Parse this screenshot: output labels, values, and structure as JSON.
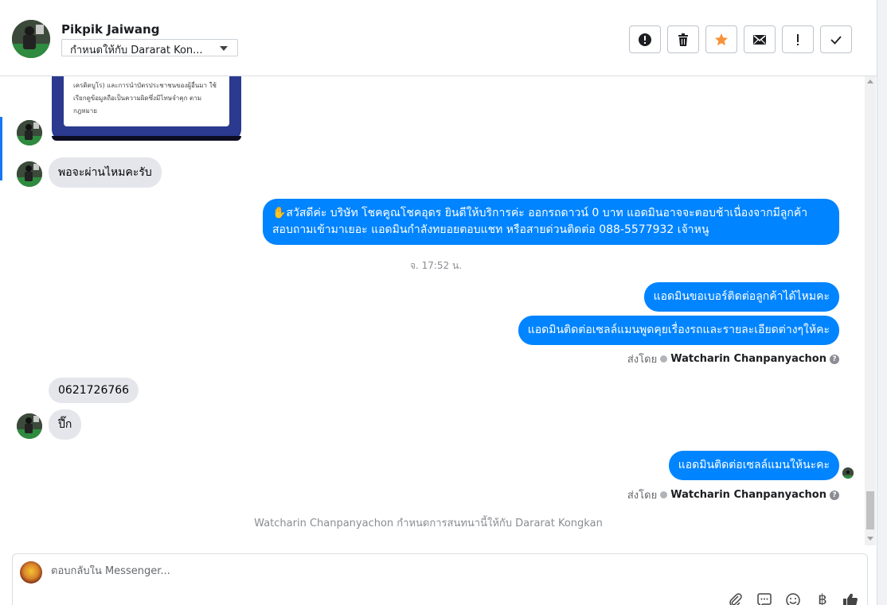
{
  "header": {
    "contact_name": "Pikpik Jaiwang",
    "assign_label": "กำหนดให้กับ Dararat Kon..."
  },
  "toolbar": {
    "buttons": [
      {
        "name": "spam-button",
        "icon": "alert-circle-icon"
      },
      {
        "name": "delete-button",
        "icon": "trash-icon"
      },
      {
        "name": "follow-up-button",
        "icon": "star-icon"
      },
      {
        "name": "mark-unread-button",
        "icon": "envelope-icon"
      },
      {
        "name": "mark-important-button",
        "icon": "exclamation-icon"
      },
      {
        "name": "mark-done-button",
        "icon": "checkmark-icon"
      }
    ]
  },
  "colors": {
    "outgoing_bubble": "#0084ff",
    "incoming_bubble": "#e4e6eb",
    "accent": "#1877f2",
    "star": "#f7923a"
  },
  "messages": {
    "image_text": "เครดิตบูโร) และการนำบัตรประชาชนของผู้อื่นมา ใช้เรียกดูข้อมูลถือเป็นความผิดซึ่งมีโทษจำคุก ตามกฎหมาย",
    "in_1": "พอจะผ่านไหมคะรับ",
    "out_1": "✋สวัสดีค่ะ บริษัท โชคคูณโชคอุดร ยินดีให้บริการค่ะ ออกรถดาวน์ 0 บาท แอดมินอาจจะตอบช้าเนื่องจากมีลูกค้าสอบถามเข้ามาเยอะ แอดมินกำลังทยอยตอบแชท หรือสายด่วนติดต่อ 088-5577932 เจ้าหนู",
    "timestamp": "จ. 17:52 น.",
    "out_2": "แอดมินขอเบอร์ติดต่อลูกค้าได้ไหมคะ",
    "out_3": "แอดมินติดต่อเซลล์แมนพูดคุยเรื่องรถและรายละเอียดต่างๆให้คะ",
    "sent_by_label": "ส่งโดย",
    "sent_by_name": "Watcharin Chanpanyachon",
    "help_mark": "?",
    "in_2": "0621726766",
    "in_3": "ปึ๊ก",
    "out_4": "แอดมินติดต่อเซลล์แมนให้นะคะ",
    "system_note": "Watcharin Chanpanyachon กำหนดการสนทนานี้ให้กับ Dararat Kongkan"
  },
  "composer": {
    "placeholder": "ตอบกลับใน Messenger...",
    "icons": [
      "attachment-icon",
      "saved-reply-icon",
      "emoji-icon",
      "baht-icon",
      "thumbs-up-icon"
    ],
    "baht_symbol": "฿"
  }
}
